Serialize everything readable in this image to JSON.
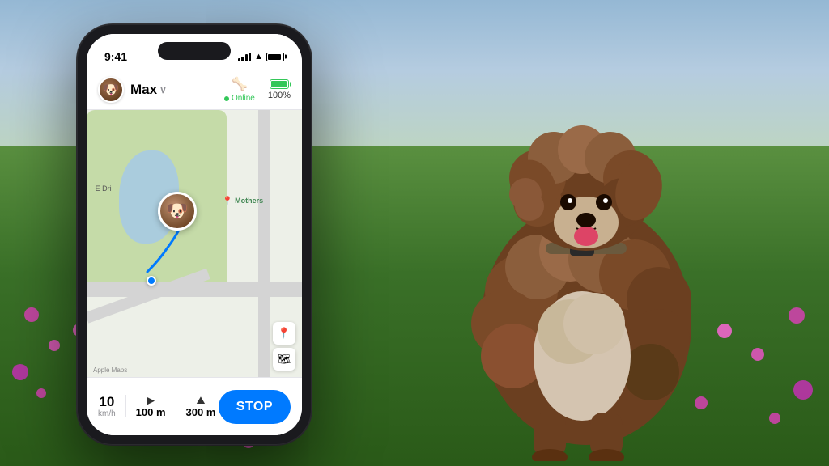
{
  "background": {
    "sky_color_top": "#7ba8c8",
    "sky_color_bottom": "#9bbcd4",
    "field_color": "#4a8030"
  },
  "phone": {
    "status_bar": {
      "time": "9:41",
      "signal": "●●●",
      "wifi": "wifi",
      "battery_label": "battery"
    },
    "pet_header": {
      "pet_name": "Max",
      "chevron": "∨",
      "online_label": "Online",
      "battery_percent": "100%",
      "tracker_icon": "🦴"
    },
    "map": {
      "attribution": "Apple Maps",
      "location_label": "Mothers",
      "road_label": "E Dri"
    },
    "bottom_bar": {
      "speed_value": "10",
      "speed_unit": "km/h",
      "distance_value": "100 m",
      "distance_icon": "▶",
      "altitude_value": "300 m",
      "altitude_icon": "⛰",
      "stop_button_label": "STOP"
    }
  }
}
